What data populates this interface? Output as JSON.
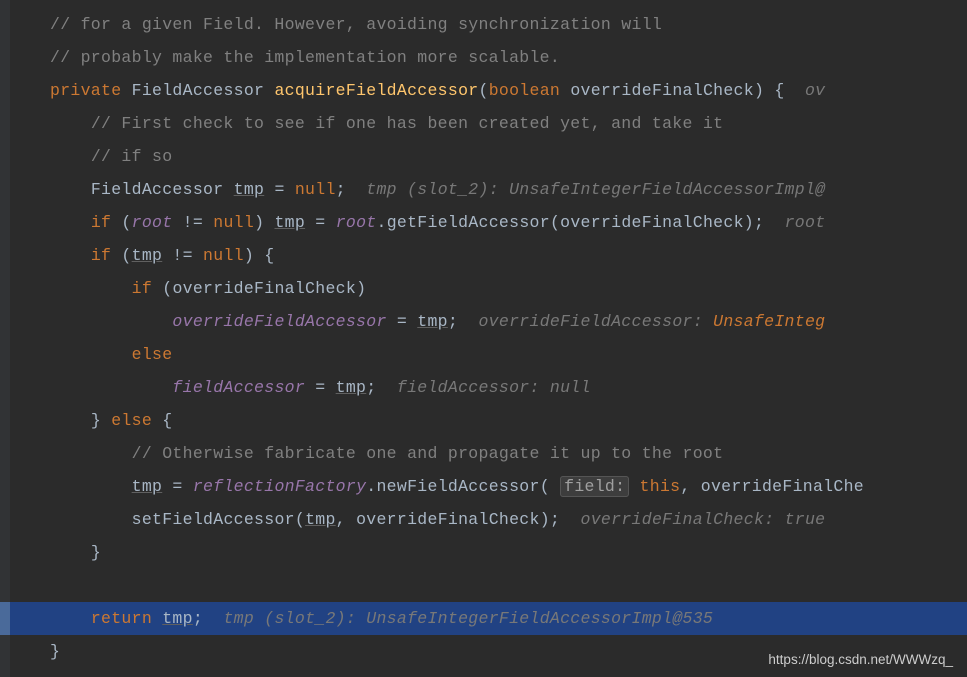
{
  "lines": {
    "c1": "// for a given Field. However, avoiding synchronization will",
    "c2": "// probably make the implementation more scalable.",
    "k_private": "private",
    "t_fieldaccessor": "FieldAccessor",
    "m_acquire": "acquireFieldAccessor",
    "k_boolean": "boolean",
    "p_override": "overrideFinalCheck",
    "brace_open": ") {",
    "hint_ov1": "ov",
    "c3": "// First check to see if one has been created yet, and take it",
    "c4": "// if so",
    "v_tmp": "tmp",
    "eq": " = ",
    "k_null": "null",
    "semi": ";",
    "hint_tmp1": "tmp (slot_2): UnsafeIntegerFieldAccessorImpl@",
    "k_if": "if",
    "v_root": "root",
    "ne": " != ",
    "rparen_sp": ") ",
    "dot": ".",
    "m_getfa": "getFieldAccessor",
    "hint_root": "root",
    "lparen": "(",
    "rparen_brace": ") {",
    "v_overrideFA": "overrideFieldAccessor",
    "hint_ofa": "overrideFieldAccessor: ",
    "hint_unsafe": "UnsafeInteg",
    "k_else": "else",
    "v_fieldAccessor": "fieldAccessor",
    "hint_fa_null": "fieldAccessor: null",
    "brace_close_else": "} ",
    "brace_open2": " {",
    "c5": "// Otherwise fabricate one and propagate it up to the root",
    "v_reflectionFactory": "reflectionFactory",
    "m_newfa": "newFieldAccessor",
    "param_field": "field:",
    "k_this": "this",
    "comma": ", ",
    "p_ofc": "overrideFinalChe",
    "m_setfa": "setFieldAccessor",
    "hint_ofc_true": "overrideFinalCheck: true",
    "brace_close": "}",
    "k_return": "return",
    "hint_tmp2": "tmp (slot_2): UnsafeIntegerFieldAccessorImpl@535"
  },
  "watermark": "https://blog.csdn.net/WWWzq_"
}
